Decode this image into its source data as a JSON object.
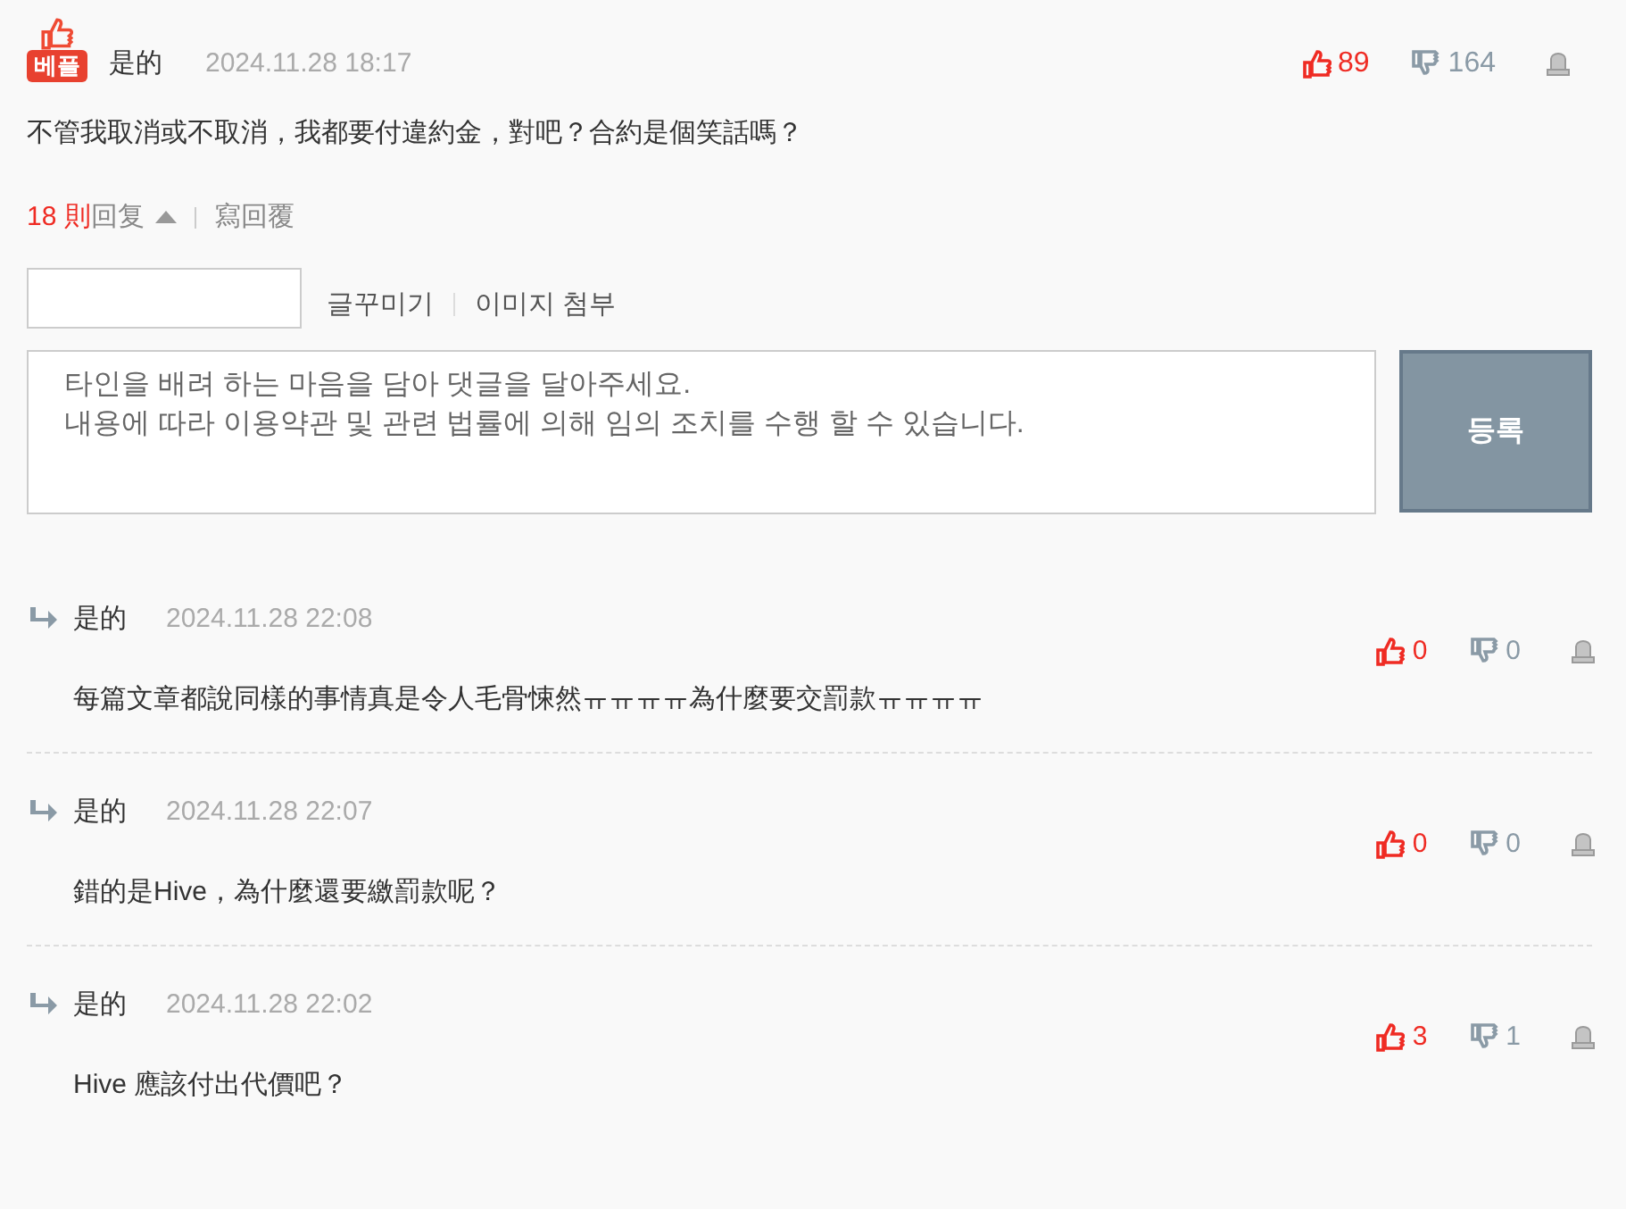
{
  "comment": {
    "badge": "베플",
    "author": "是的",
    "date": "2024.11.28 18:17",
    "likes": "89",
    "dislikes": "164",
    "text": "不管我取消或不取消，我都要付違約金，對吧？合約是個笑話嗎？",
    "reply_count": "18 則",
    "reply_label": "回复",
    "replies_expanded": true,
    "write_reply": "寫回覆"
  },
  "editor": {
    "tools": [
      "글꾸미기",
      "이미지 첨부"
    ],
    "placeholder": "타인을 배려 하는 마음을 담아 댓글을 달아주세요.\n내용에 따라 이용약관 및 관련 법률에 의해 임의 조치를 수행 할 수 있습니다.",
    "submit": "등록"
  },
  "replies": [
    {
      "author": "是的",
      "date": "2024.11.28 22:08",
      "likes": "0",
      "dislikes": "0",
      "text": "每篇文章都說同樣的事情真是令人毛骨悚然ㅠㅠㅠㅠ為什麼要交罰款ㅠㅠㅠㅠ"
    },
    {
      "author": "是的",
      "date": "2024.11.28 22:07",
      "likes": "0",
      "dislikes": "0",
      "text": "錯的是Hive，為什麼還要繳罰款呢？"
    },
    {
      "author": "是的",
      "date": "2024.11.28 22:02",
      "likes": "3",
      "dislikes": "1",
      "text": "Hive 應該付出代價吧？"
    }
  ]
}
